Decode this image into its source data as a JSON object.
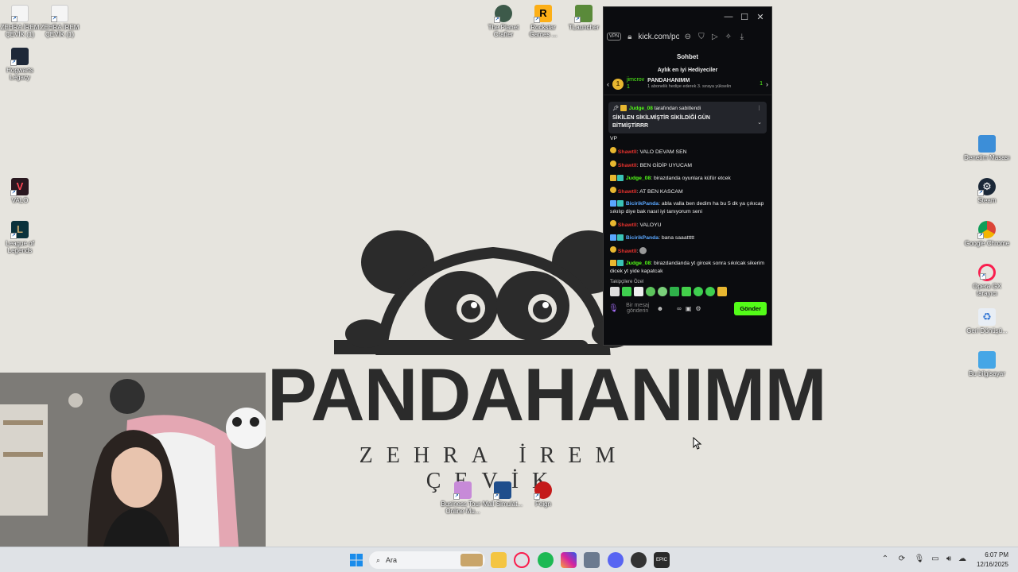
{
  "wallpaper": {
    "title": "PANDAHANIMM",
    "subtitle": "ZEHRA İREM ÇEVİK"
  },
  "desktop_icons": [
    {
      "label": "ZEHRA İREM ÇEVİK (1)",
      "icon": "document-icon"
    },
    {
      "label": "ZEHRA İREM ÇEVİK (1)",
      "icon": "document-icon"
    },
    {
      "label": "Hogwarts Legacy",
      "icon": "hogwarts-icon"
    },
    {
      "label": "VALO",
      "icon": "valorant-icon"
    },
    {
      "label": "League of Legends",
      "icon": "league-icon"
    },
    {
      "label": "The Planet Crafter",
      "icon": "planet-icon"
    },
    {
      "label": "Rockstar Games ...",
      "icon": "rockstar-icon",
      "glyph": "R"
    },
    {
      "label": "TLauncher",
      "icon": "minecraft-icon"
    },
    {
      "label": "Denetim Masası",
      "icon": "control-panel-icon"
    },
    {
      "label": "Steam",
      "icon": "steam-icon"
    },
    {
      "label": "Google Chrome",
      "icon": "chrome-icon"
    },
    {
      "label": "Opera GX tarayıcı",
      "icon": "opera-gx-icon"
    },
    {
      "label": "Geri Dönüşü...",
      "icon": "recycle-bin-icon"
    },
    {
      "label": "Bu bilgisayar",
      "icon": "computer-icon"
    },
    {
      "label": "Business Tour - Online Mu...",
      "icon": "business-tour-icon"
    },
    {
      "label": "Mall Simulat...",
      "icon": "mall-sim-icon"
    },
    {
      "label": "Feign",
      "icon": "feign-icon"
    }
  ],
  "browser": {
    "vpn_label": "VPN",
    "url": "kick.com/po",
    "chat_title": "Sohbet",
    "gifters_title": "Aylık en iyi Hediyeciler",
    "gifter_name": "jimcrov",
    "gifter_count": "1",
    "gifter_rank": "1",
    "streamer_name": "PANDAHANIMM",
    "streamer_count": "1",
    "gift_hint": "1 abonelik hediye ederek 3. sıraya yükselin",
    "pinned": {
      "author": "Judge_08",
      "by_text": "tarafından sabitlendi",
      "message": "SİKİLEN SİKİLMİŞTİR SİKİLDİĞİ GÜN BİTMİŞTİRRR"
    },
    "partial_line": "VP",
    "messages": [
      {
        "user": "Shawtll",
        "text": ": VALO DEVAM SEN",
        "color": "red"
      },
      {
        "user": "Shawtll",
        "text": ": BEN GİDİP UYUCAM",
        "color": "red"
      },
      {
        "user": "Judge_08",
        "text": ": birazdanda oyunlara küfür etcek",
        "color": "green"
      },
      {
        "user": "Shawtll",
        "text": ": AT BEN KASCAM",
        "color": "red"
      },
      {
        "user": "BicirikPanda",
        "text": ": abla valla ben dedim ha bu 5 dk ya çıkıcap sıkılıp diye bak nasıl iyi tanıyorum seni",
        "color": "blue"
      },
      {
        "user": "Shawtll",
        "text": ": VALOYU",
        "color": "red"
      },
      {
        "user": "BicirikPanda",
        "text": ": bana saaattttt",
        "color": "blue"
      },
      {
        "user": "Shawtll",
        "text": ":",
        "color": "red"
      },
      {
        "user": "Judge_08",
        "text": ": birazdandanda yt gircek sonra sıkılcak sikerim dicek yt yide kapatcak",
        "color": "green"
      }
    ],
    "emote_label": "Takipçilere Özel",
    "input_placeholder": "Bir mesaj gönderin",
    "send_label": "Gönder"
  },
  "taskbar": {
    "search_placeholder": "Ara",
    "time": "6:07 PM",
    "date": "12/16/2025"
  },
  "colors": {
    "kick_green": "#53fc18",
    "chat_bg": "#0b0c0f",
    "desktop_bg": "#e6e4de"
  }
}
